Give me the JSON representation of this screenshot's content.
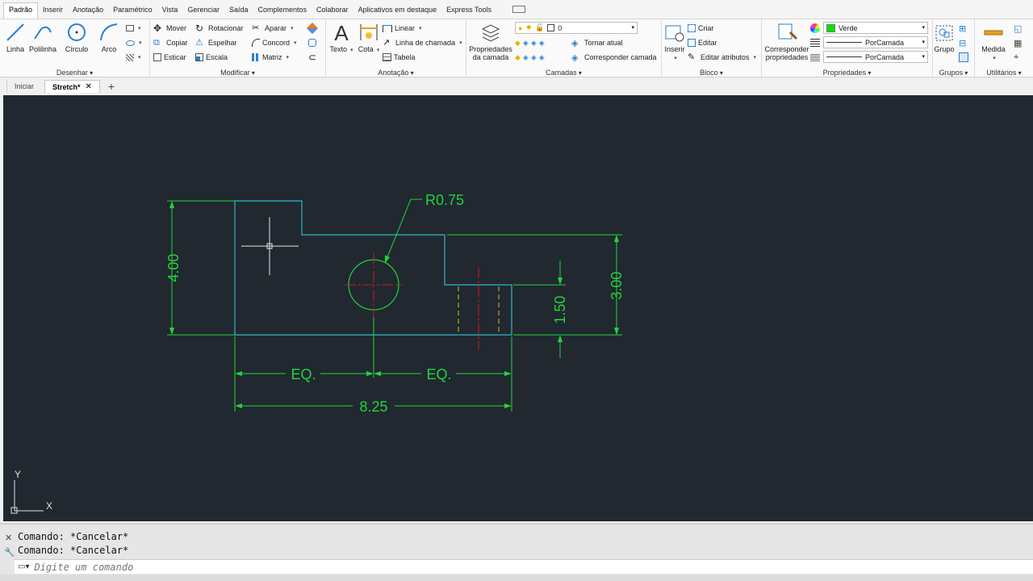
{
  "ribbon_tabs": [
    "Padrão",
    "Inserir",
    "Anotação",
    "Paramétrico",
    "Vista",
    "Gerenciar",
    "Saída",
    "Complementos",
    "Colaborar",
    "Aplicativos em destaque",
    "Express Tools"
  ],
  "active_ribbon_tab": "Padrão",
  "panels": {
    "draw": {
      "title": "Desenhar",
      "line": "Linha",
      "polyline": "Polilinha",
      "circle": "Círculo",
      "arc": "Arco"
    },
    "modify": {
      "title": "Modificar",
      "move": "Mover",
      "rotate": "Rotacionar",
      "trim": "Aparar",
      "copy": "Copiar",
      "mirror": "Espelhar",
      "fillet": "Concord",
      "stretch": "Esticar",
      "scale": "Escala",
      "array": "Matriz"
    },
    "annotation": {
      "title": "Anotação",
      "text": "Texto",
      "dimension": "Cota",
      "linear": "Linear",
      "leader": "Linha de chamada",
      "table": "Tabela"
    },
    "layers": {
      "title": "Camadas",
      "layer_props_line1": "Propriedades",
      "layer_props_line2": "da camada",
      "current_layer": "0",
      "make_current": "Tornar atual",
      "match_layer": "Corresponder camada"
    },
    "block": {
      "title": "Bloco",
      "insert": "Inserir",
      "create": "Criar",
      "edit": "Editar",
      "edit_attributes": "Editar atributos"
    },
    "properties": {
      "title": "Propriedades",
      "match_line1": "Corresponder",
      "match_line2": "propriedades",
      "color": "Verde",
      "color_hex": "#00e600",
      "linetype": "PorCamada",
      "lineweight": "PorCamada"
    },
    "groups": {
      "title": "Grupos",
      "group": "Grupo"
    },
    "utilities": {
      "title": "Utilitários",
      "measure": "Medida"
    }
  },
  "doc_tabs": [
    {
      "label": "Iniciar",
      "active": false
    },
    {
      "label": "Stretch*",
      "active": true
    }
  ],
  "drawing": {
    "radius_label": "R0.75",
    "dim_height_left": "4.00",
    "dim_height_right": "3.00",
    "dim_slot": "1.50",
    "dim_eq_left": "EQ.",
    "dim_eq_right": "EQ.",
    "dim_total_width": "8.25",
    "ucs_x": "X",
    "ucs_y": "Y",
    "colors": {
      "background": "#212830",
      "object": "#2fb8c6",
      "dimension": "#22d43a",
      "center": "#d01818",
      "hidden": "#d4c020"
    }
  },
  "command": {
    "history": [
      "Comando: *Cancelar*",
      "Comando: *Cancelar*"
    ],
    "placeholder": "Digite um comando"
  }
}
